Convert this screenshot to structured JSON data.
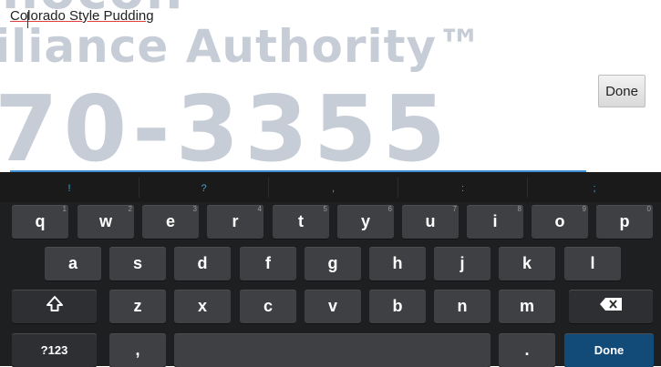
{
  "background": {
    "line1": "nocoll",
    "line2": "iliance Authority™",
    "line3": "70-3355"
  },
  "editor": {
    "text": "Colorado Style Pudding"
  },
  "done_button": {
    "label": "Done"
  },
  "keyboard": {
    "suggestions": [
      "!",
      "?",
      ",",
      ":",
      ";"
    ],
    "row1": [
      {
        "label": "q",
        "hint": "1"
      },
      {
        "label": "w",
        "hint": "2"
      },
      {
        "label": "e",
        "hint": "3"
      },
      {
        "label": "r",
        "hint": "4"
      },
      {
        "label": "t",
        "hint": "5"
      },
      {
        "label": "y",
        "hint": "6"
      },
      {
        "label": "u",
        "hint": "7"
      },
      {
        "label": "i",
        "hint": "8"
      },
      {
        "label": "o",
        "hint": "9"
      },
      {
        "label": "p",
        "hint": "0"
      }
    ],
    "row2": [
      "a",
      "s",
      "d",
      "f",
      "g",
      "h",
      "j",
      "k",
      "l"
    ],
    "row3": [
      "z",
      "x",
      "c",
      "v",
      "b",
      "n",
      "m"
    ],
    "shift_icon": "shift-icon",
    "backspace_icon": "backspace-icon",
    "symbols_label": "?123",
    "comma_label": ",",
    "period_label": ".",
    "done_label": "Done",
    "accent": "#124a78",
    "suggestion_color": "#34a7d8"
  }
}
